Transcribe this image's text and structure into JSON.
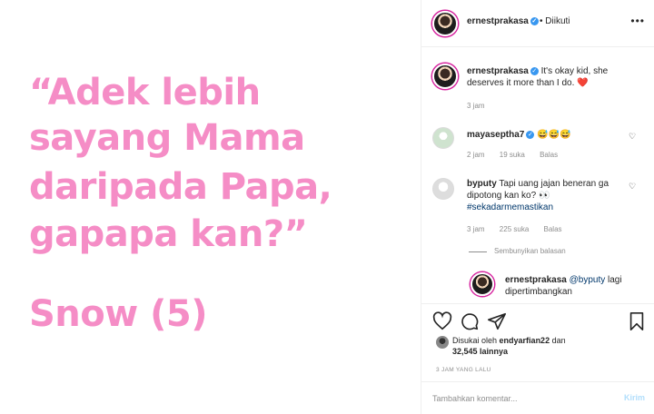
{
  "image": {
    "quote_lines": [
      "“Adek lebih",
      "sayang Mama",
      "daripada Papa,",
      "gapapa kan?”"
    ],
    "author": "Snow (5)",
    "text_color": "#f58dc6"
  },
  "header": {
    "username": "ernestprakasa",
    "separator": "•",
    "follow_status": "Diikuti"
  },
  "caption": {
    "username": "ernestprakasa",
    "text": "It's okay kid, she deserves it more than I do.",
    "emoji": "❤️",
    "time": "3 jam"
  },
  "comments": [
    {
      "username": "mayaseptha7",
      "text": "😅😅😅",
      "time": "2 jam",
      "likes": "19 suka",
      "reply": "Balas"
    },
    {
      "username": "byputy",
      "text": "Tapi uang jajan beneran ga dipotong kan ko? 👀",
      "hashtag": "#sekadarmemastikan",
      "time": "3 jam",
      "likes": "225 suka",
      "reply": "Balas"
    }
  ],
  "hide_replies": "Sembunyikan balasan",
  "reply": {
    "username": "ernestprakasa",
    "mention": "@byputy",
    "text": "lagi dipertimbangkan"
  },
  "likes": {
    "prefix": "Disukai oleh",
    "user": "endyarfian22",
    "connector": "dan",
    "count": "32,545 lainnya"
  },
  "time_ago": "3 JAM YANG LALU",
  "comment_input": {
    "placeholder": "Tambahkan komentar...",
    "post_label": "Kirim"
  },
  "colors": {
    "verified": "#3897f0",
    "heart": "#ed4956",
    "post_button": "#b2dffc"
  }
}
